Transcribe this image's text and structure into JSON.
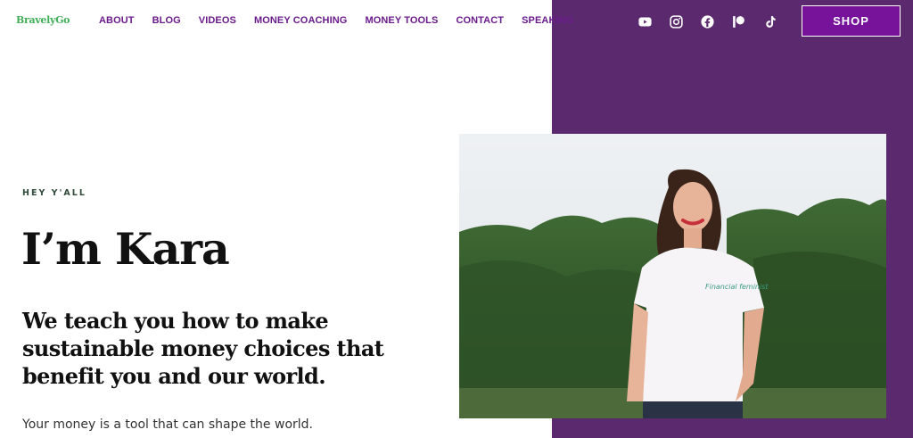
{
  "brand": {
    "logo_text": "BravelyGo"
  },
  "nav": {
    "items": [
      {
        "label": "ABOUT"
      },
      {
        "label": "BLOG"
      },
      {
        "label": "VIDEOS"
      },
      {
        "label": "MONEY COACHING"
      },
      {
        "label": "MONEY TOOLS"
      },
      {
        "label": "CONTACT"
      },
      {
        "label": "SPEAKING"
      }
    ]
  },
  "social": [
    "youtube-icon",
    "instagram-icon",
    "facebook-icon",
    "patreon-icon",
    "tiktok-icon"
  ],
  "header": {
    "shop_label": "SHOP"
  },
  "hero": {
    "eyebrow": "HEY Y'ALL",
    "title": "I’m Kara",
    "subtitle": "We teach you how to make sustainable money choices that benefit you and our world.",
    "tagline": "Your money is a tool that can shape the world.",
    "shirt_text": "Financial feminist"
  },
  "colors": {
    "panel": "#5b2a6e",
    "nav_text": "#6a1b8a",
    "shop_bg": "#76139a",
    "logo": "#3fae56"
  }
}
